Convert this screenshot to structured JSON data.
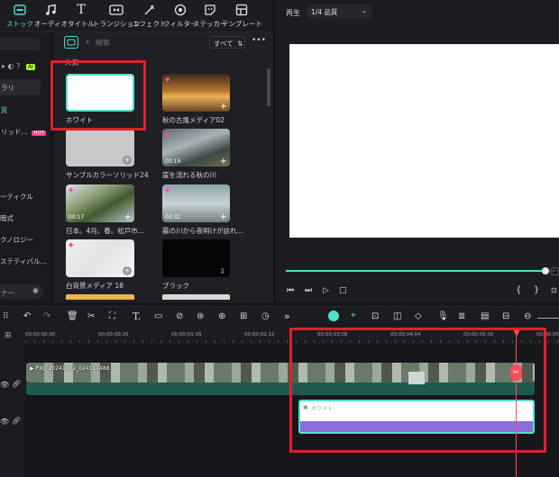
{
  "tabs": [
    {
      "label": "ストック",
      "icon": "stock-icon"
    },
    {
      "label": "オーディオ",
      "icon": "music-icon"
    },
    {
      "label": "タイトル",
      "icon": "title-icon"
    },
    {
      "label": "トランジション",
      "icon": "transition-icon"
    },
    {
      "label": "エフェクト",
      "icon": "effect-icon"
    },
    {
      "label": "フィルター",
      "icon": "filter-icon"
    },
    {
      "label": "ステッカー",
      "icon": "sticker-icon"
    },
    {
      "label": "テンプレート",
      "icon": "template-icon"
    }
  ],
  "sidebar": {
    "items": [
      "ラリ",
      "質",
      "リッド...",
      "ーティクル",
      "暗式",
      "クノロジー",
      "ステティバル...",
      "ナー"
    ],
    "ai_badge": "AI",
    "hot_badge": "HOT"
  },
  "media": {
    "search_placeholder": "検索",
    "filter_label": "すべて",
    "section_label": "人気",
    "items": [
      {
        "label": "ホワイト"
      },
      {
        "label": "秋の古風メディア02"
      },
      {
        "label": "サンプルカラーソリッド24"
      },
      {
        "label": "崖を流れる秋の川",
        "duration": "00:19"
      },
      {
        "label": "日本。4月。春。松戸市...",
        "duration": "00:17"
      },
      {
        "label": "霧の川から夜明けが訪れ...",
        "duration": "00:32"
      },
      {
        "label": "白背景メディア 18"
      },
      {
        "label": "ブラック"
      }
    ]
  },
  "preview": {
    "play_label": "再生",
    "quality_label": "1/4 品質",
    "progress": 0.96
  },
  "timeline": {
    "ruler": [
      "00:00:00:00",
      "00:00:00:20",
      "00:00:01:16",
      "00:00:02:12",
      "00:00:03:08",
      "00:00:04:04",
      "00:00:05:00",
      "00:00:05"
    ],
    "video_clip_label": "PXL_20241002_024117488...",
    "white_clip_label": "ホワイト"
  }
}
